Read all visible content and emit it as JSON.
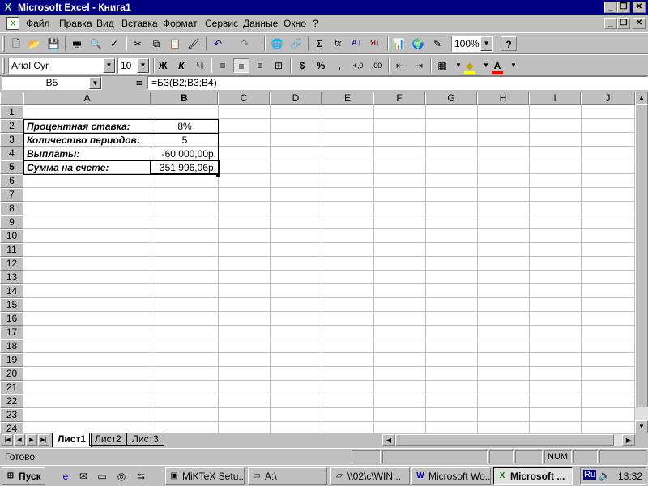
{
  "window": {
    "title": "Microsoft Excel - Книга1",
    "logo": "X",
    "minimize_glyph": "_",
    "maximize_glyph": "❐",
    "close_glyph": "✕"
  },
  "menu": [
    "Файл",
    "Правка",
    "Вид",
    "Вставка",
    "Формат",
    "Сервис",
    "Данные",
    "Окно",
    "?"
  ],
  "toolbar_standard": {
    "icons": [
      "new-icon",
      "open-icon",
      "save-icon",
      "print-icon",
      "print-preview-icon",
      "spelling-icon",
      "cut-icon",
      "copy-icon",
      "paste-icon",
      "format-painter-icon",
      "undo-icon",
      "redo-icon",
      "web-toolbar-icon",
      "hyperlink-icon",
      "autosum-icon",
      "function-icon",
      "sort-ascending-icon",
      "sort-descending-icon",
      "chart-wizard-icon",
      "map-icon",
      "drawing-icon",
      "help-icon"
    ],
    "glyphs": [
      "🗋",
      "📂",
      "💾",
      "🖶",
      "🔍",
      "✓",
      "✂",
      "⧉",
      "📋",
      "🖌",
      "↶",
      "↷",
      "🌐",
      "🔗",
      "Σ",
      "fx",
      "A↓",
      "Я↓",
      "📊",
      "🌍",
      "✎",
      "?"
    ],
    "zoom": "100%"
  },
  "toolbar_format": {
    "font_name": "Arial Cyr",
    "font_size": "10",
    "bold": "Ж",
    "italic": "К",
    "underline": "Ч",
    "percent": "%",
    "comma": ",",
    "inc_decimal": "+,0",
    "dec_decimal": ",00",
    "currency": "$",
    "font_color_letter": "A",
    "glyphs": [
      "≡",
      "≡",
      "≡",
      "⊞",
      "⇤",
      "⇥",
      "▦",
      "◆"
    ]
  },
  "formula_bar": {
    "name_box": "B5",
    "equals": "=",
    "formula": "=БЗ(B2;B3;B4)"
  },
  "columns": [
    "A",
    "B",
    "C",
    "D",
    "E",
    "F",
    "G",
    "H",
    "I",
    "J"
  ],
  "rows": [
    "1",
    "2",
    "3",
    "4",
    "5",
    "6",
    "7",
    "8",
    "9",
    "10",
    "11",
    "12",
    "13",
    "14",
    "15",
    "16",
    "17",
    "18",
    "19",
    "20",
    "21",
    "22",
    "23",
    "24"
  ],
  "cells": {
    "a2": "Процентная ставка:",
    "a3": "Количество периодов:",
    "a4": "Выплаты:",
    "a5": "Сумма на счете:",
    "b2": "8%",
    "b3": "5",
    "b4": "-60 000,00р.",
    "b5": "351 996,06р."
  },
  "sheets": [
    "Лист1",
    "Лист2",
    "Лист3"
  ],
  "status": {
    "ready": "Готово",
    "num": "NUM"
  },
  "taskbar": {
    "start": "Пуск",
    "tasks": [
      "MiKTeX Setu...",
      "A:\\",
      "\\\\02\\c\\WIN...",
      "Microsoft Wo...",
      "Microsoft ..."
    ],
    "lang": "Ru",
    "clock": "13:32"
  }
}
